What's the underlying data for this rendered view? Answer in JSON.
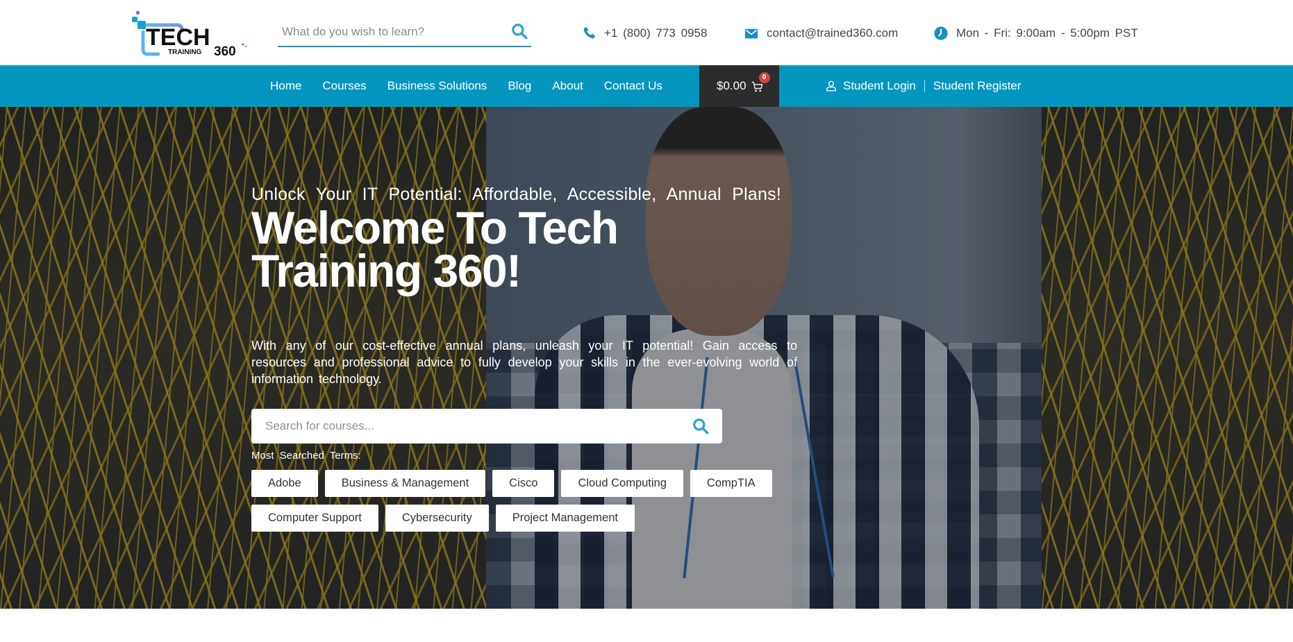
{
  "brand": {
    "logo_main": "TECH",
    "logo_sub": "TRAINING",
    "logo_num": "360",
    "accent_color": "#0596c0",
    "cart_bg": "#2c2c2c",
    "badge_color": "#d14444"
  },
  "header": {
    "search_placeholder": "What do you wish to learn?",
    "search_icon": "search-icon",
    "contacts": [
      {
        "icon": "phone-icon",
        "text": "+1 (800) 773 0958"
      },
      {
        "icon": "envelope-icon",
        "text": "contact@trained360.com"
      },
      {
        "icon": "clock-icon",
        "text": "Mon - Fri: 9:00am - 5:00pm PST"
      }
    ]
  },
  "nav": {
    "links": [
      "Home",
      "Courses",
      "Business Solutions",
      "Blog",
      "About",
      "Contact Us"
    ],
    "cart_total": "$0.00",
    "cart_count": "0",
    "login_label": "Student Login",
    "register_label": "Student Register"
  },
  "hero": {
    "tagline": "Unlock Your IT Potential: Affordable, Accessible, Annual Plans!",
    "title_line1": "Welcome To Tech",
    "title_line2": "Training 360!",
    "description": "With any of our cost-effective annual plans, unleash your IT potential! Gain access to resources and professional advice to fully develop your skills in the ever-evolving world of information technology.",
    "search_placeholder": "Search for courses...",
    "terms_label": "Most Searched Terms:",
    "terms": [
      "Adobe",
      "Business & Management",
      "Cisco",
      "Cloud Computing",
      "CompTIA",
      "Computer Support",
      "Cybersecurity",
      "Project Management"
    ]
  }
}
